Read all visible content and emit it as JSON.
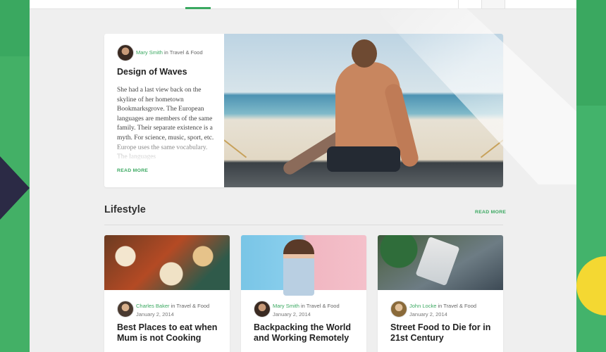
{
  "featured": {
    "author": "Mary Smith",
    "in_text": " in ",
    "category": "Travel & Food",
    "title": "Design of Waves",
    "excerpt": "She had a last view back on the skyline of her hometown Bookmarksgrove. The European languages are members of the same family. Their separate existence is a myth. For science, music, sport, etc. Europe uses the same vocabulary. The languages",
    "read_more": "READ MORE"
  },
  "section": {
    "title": "Lifestyle",
    "read_more": "READ MORE"
  },
  "cards": [
    {
      "author": "Charles Baker",
      "in_text": " in ",
      "category": "Travel & Food",
      "date": "January 2, 2014",
      "title": "Best Places to eat when Mum is not Cooking"
    },
    {
      "author": "Mary Smith",
      "in_text": " in ",
      "category": "Travel & Food",
      "date": "January 2, 2014",
      "title": "Backpacking the World and Working Remotely"
    },
    {
      "author": "John Locke",
      "in_text": " in ",
      "category": "Travel & Food",
      "date": "January 2, 2014",
      "title": "Street Food to Die for in 21st Century"
    }
  ],
  "colors": {
    "accent": "#3aa860",
    "background": "#3aa860",
    "page": "#efefef",
    "yellow": "#f4d832",
    "dark_shape": "#2b2a45"
  }
}
